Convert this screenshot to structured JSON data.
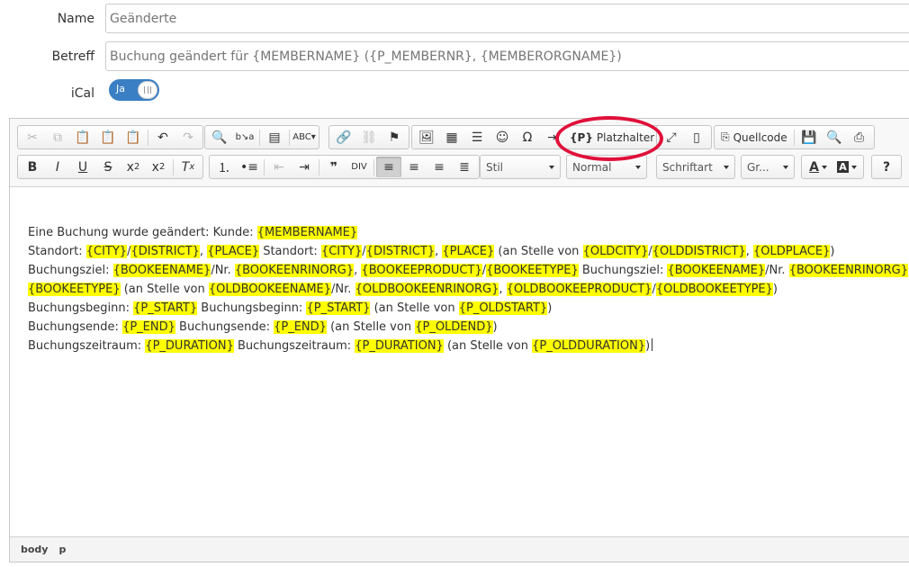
{
  "form": {
    "name_label": "Name",
    "name_placeholder": "Geänderte",
    "subject_label": "Betreff",
    "subject_placeholder": "Buchung geändert für {MEMBERNAME} ({P_MEMBERNR}, {MEMBERORGNAME})",
    "ical_label": "iCal",
    "ical_toggle_text": "Ja"
  },
  "toolbar": {
    "placeholder_label": "Platzhalter",
    "placeholder_icon_text": "{P}",
    "source_label": "Quellcode",
    "style_combo": "Stil",
    "format_combo": "Normal",
    "font_combo": "Schriftart",
    "size_combo": "Gr...",
    "help_label": "?"
  },
  "content": {
    "line1": {
      "t1": "Eine Buchung wurde geändert: Kunde: ",
      "p1": "{MEMBERNAME}"
    },
    "line2": {
      "t1": "Standort: ",
      "p1": "{CITY}",
      "t2": "/",
      "p2": "{DISTRICT}",
      "t3": ", ",
      "p3": "{PLACE}",
      "t4": " Standort: ",
      "p4": "{CITY}",
      "t5": "/",
      "p5": "{DISTRICT}",
      "t6": ", ",
      "p6": "{PLACE}",
      "t7": " (an Stelle von ",
      "p7": "{OLDCITY}",
      "t8": "/",
      "p8": "{OLDDISTRICT}",
      "t9": ", ",
      "p9": "{OLDPLACE}",
      "t10": ")"
    },
    "line3": {
      "t1": "Buchungsziel: ",
      "p1": "{BOOKEENAME}",
      "t2": "/Nr. ",
      "p2": "{BOOKEENRINORG}",
      "t3": ", ",
      "p3": "{BOOKEEPRODUCT}",
      "t4": "/",
      "p4": "{BOOKEETYPE}",
      "t5": " Buchungsziel: ",
      "p5": "{BOOKEENAME}",
      "t6": "/Nr. ",
      "p6": "{BOOKEENRINORG}",
      "t7": ","
    },
    "line4": {
      "p1": "{BOOKEETYPE}",
      "t1": " (an Stelle von ",
      "p2": "{OLDBOOKEENAME}",
      "t2": "/Nr. ",
      "p3": "{OLDBOOKEENRINORG}",
      "t3": ", ",
      "p4": "{OLDBOOKEEPRODUCT}",
      "t4": "/",
      "p5": "{OLDBOOKEETYPE}",
      "t5": ")"
    },
    "line5": {
      "t1": "Buchungsbeginn: ",
      "p1": "{P_START}",
      "t2": " Buchungsbeginn: ",
      "p2": "{P_START}",
      "t3": " (an Stelle von ",
      "p3": "{P_OLDSTART}",
      "t4": ")"
    },
    "line6": {
      "t1": "Buchungsende: ",
      "p1": "{P_END}",
      "t2": " Buchungsende: ",
      "p2": "{P_END}",
      "t3": " (an Stelle von ",
      "p3": "{P_OLDEND}",
      "t4": ")"
    },
    "line7": {
      "t1": "Buchungszeitraum: ",
      "p1": "{P_DURATION}",
      "t2": " Buchungszeitraum: ",
      "p2": "{P_DURATION}",
      "t3": " (an Stelle von ",
      "p3": "{P_OLDDURATION}",
      "t4": ")"
    }
  },
  "statusbar": {
    "path1": "body",
    "path2": "p"
  },
  "colors": {
    "toggle": "#3a7fc4",
    "placeholder_highlight": "#ffff00",
    "annotation_ring": "#e0103a"
  }
}
